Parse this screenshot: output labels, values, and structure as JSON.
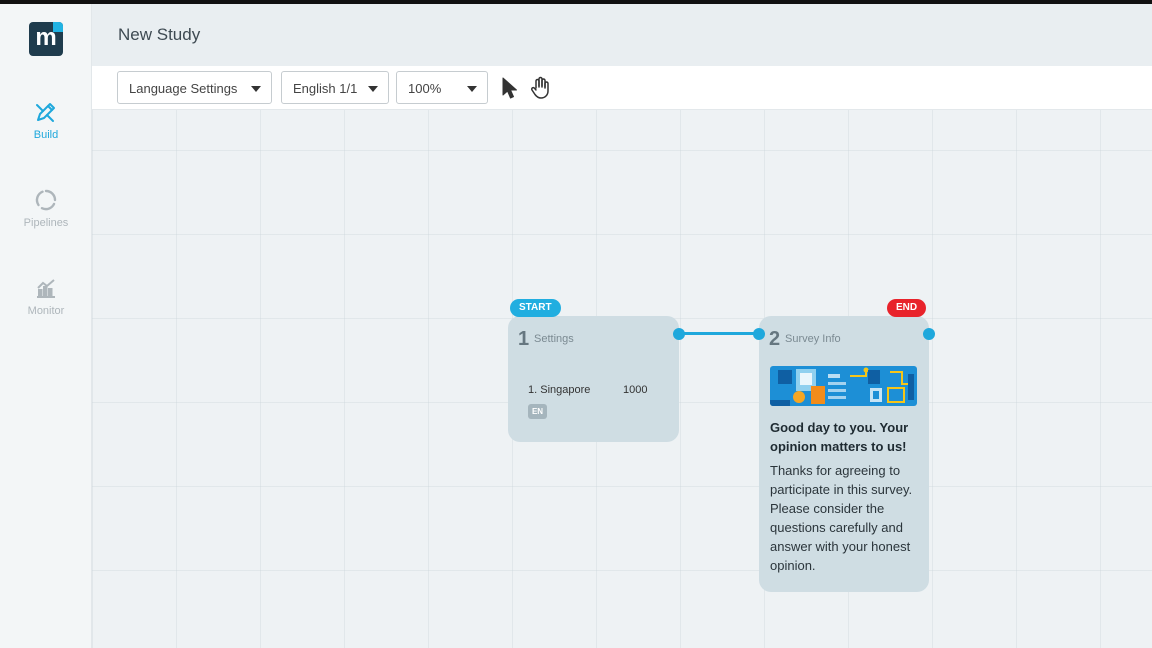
{
  "app": {
    "logo_letter": "m",
    "page_title": "New Study"
  },
  "sidebar": {
    "items": [
      {
        "label": "Build",
        "icon": "pencil-icon",
        "active": true
      },
      {
        "label": "Pipelines",
        "icon": "ring-icon",
        "active": false
      },
      {
        "label": "Monitor",
        "icon": "chart-icon",
        "active": false
      }
    ]
  },
  "toolbar": {
    "language_settings": "Language Settings",
    "language": "English 1/1",
    "zoom": "100%"
  },
  "canvas": {
    "start_badge": "START",
    "end_badge": "END",
    "nodes": [
      {
        "number": "1",
        "name": "Settings",
        "row_label": "1. Singapore",
        "row_value": "1000",
        "lang_chip": "EN"
      },
      {
        "number": "2",
        "name": "Survey Info",
        "heading": "Good day to you. Your opinion matters to us!",
        "body": "Thanks for agreeing to participate in this survey. Please consider the questions carefully and answer with your honest opinion."
      }
    ]
  },
  "colors": {
    "accent": "#1fa8dc",
    "end_badge": "#e8232b",
    "node_bg": "#cfdde3",
    "brand_dark": "#1f3c4d"
  }
}
